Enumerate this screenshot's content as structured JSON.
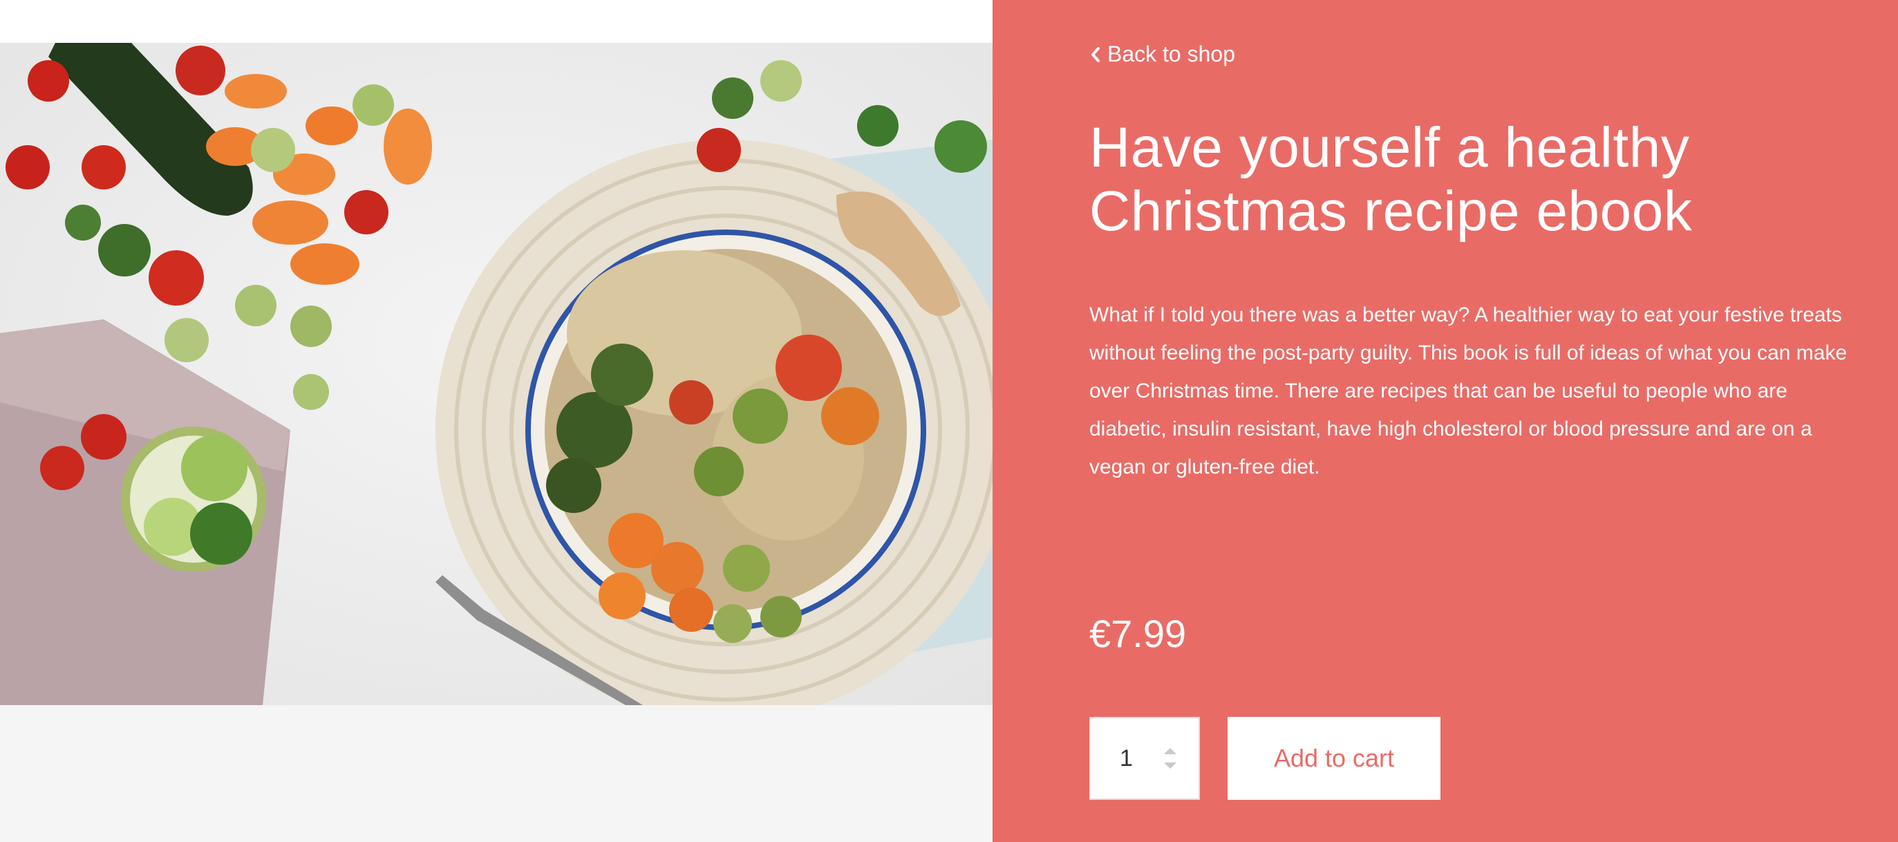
{
  "nav": {
    "back_label": "Back to shop"
  },
  "product": {
    "title": "Have yourself a healthy Christmas recipe ebook",
    "description": "What if I told you there was a better way? A healthier way to eat your festive treats without feeling the post-party guilty. This book is full of ideas of what you can make over Christmas time. There are recipes that can be useful to people who are diabetic, insulin resistant, have high cholesterol or blood pressure and are on a vegan or gluten-free diet.",
    "price": "€7.99",
    "quantity": "1",
    "add_to_cart_label": "Add to cart"
  },
  "icons": {
    "back": "chevron-left-icon",
    "stepper": "up-down-arrows-icon"
  },
  "colors": {
    "panel": "#e96b66",
    "button_text": "#e96b66",
    "text": "#ffffff"
  }
}
